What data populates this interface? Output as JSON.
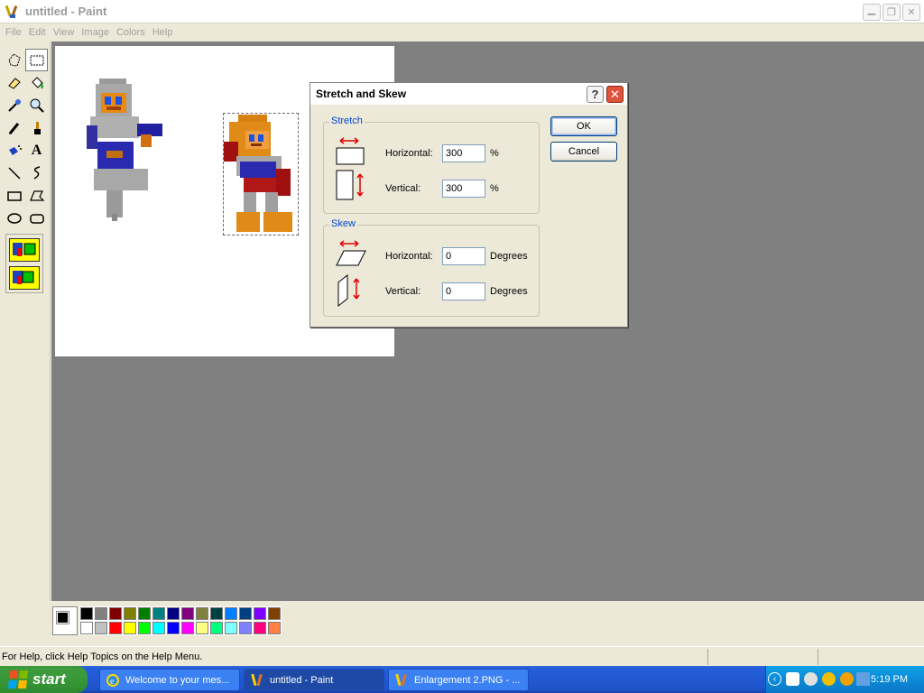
{
  "window": {
    "title": "untitled - Paint",
    "buttons": {
      "minimize": "_",
      "maximize": "❐",
      "close": "✕"
    }
  },
  "menu": [
    "File",
    "Edit",
    "View",
    "Image",
    "Colors",
    "Help"
  ],
  "tools": [
    {
      "name": "free-form-select-icon"
    },
    {
      "name": "rectangle-select-icon",
      "selected": true
    },
    {
      "name": "eraser-icon"
    },
    {
      "name": "fill-bucket-icon"
    },
    {
      "name": "pick-color-icon"
    },
    {
      "name": "magnifier-icon"
    },
    {
      "name": "pencil-icon"
    },
    {
      "name": "brush-icon"
    },
    {
      "name": "airbrush-icon"
    },
    {
      "name": "text-icon"
    },
    {
      "name": "line-icon"
    },
    {
      "name": "curve-icon"
    },
    {
      "name": "rectangle-icon"
    },
    {
      "name": "polygon-icon"
    },
    {
      "name": "ellipse-icon"
    },
    {
      "name": "rounded-rectangle-icon"
    }
  ],
  "palette": {
    "top": [
      "#000000",
      "#808080",
      "#800000",
      "#808000",
      "#008000",
      "#008080",
      "#000080",
      "#800080",
      "#808040",
      "#004040",
      "#0080ff",
      "#004080",
      "#8000ff",
      "#804000"
    ],
    "bottom": [
      "#ffffff",
      "#c0c0c0",
      "#ff0000",
      "#ffff00",
      "#00ff00",
      "#00ffff",
      "#0000ff",
      "#ff00ff",
      "#ffff80",
      "#00ff80",
      "#80ffff",
      "#8080ff",
      "#ff0080",
      "#ff8040"
    ],
    "foreground": "#000000",
    "background": "#ffffff"
  },
  "status": {
    "help_text": "For Help, click Help Topics on the Help Menu."
  },
  "dialog": {
    "title": "Stretch and Skew",
    "help_button": "?",
    "close_button": "✕",
    "stretch": {
      "label": "Stretch",
      "horizontal_label": "Horizontal:",
      "horizontal_value": "300",
      "horizontal_unit": "%",
      "vertical_label": "Vertical:",
      "vertical_value": "300",
      "vertical_unit": "%"
    },
    "skew": {
      "label": "Skew",
      "horizontal_label": "Horizontal:",
      "horizontal_value": "0",
      "horizontal_unit": "Degrees",
      "vertical_label": "Vertical:",
      "vertical_value": "0",
      "vertical_unit": "Degrees"
    },
    "ok_label": "OK",
    "cancel_label": "Cancel"
  },
  "taskbar": {
    "start_label": "start",
    "buttons": [
      {
        "label": "Welcome to your mes...",
        "icon": "ie-icon"
      },
      {
        "label": "untitled - Paint",
        "icon": "paint-icon",
        "active": true
      },
      {
        "label": "Enlargement 2.PNG - ...",
        "icon": "paint-icon"
      }
    ],
    "clock": "5:19 PM"
  }
}
